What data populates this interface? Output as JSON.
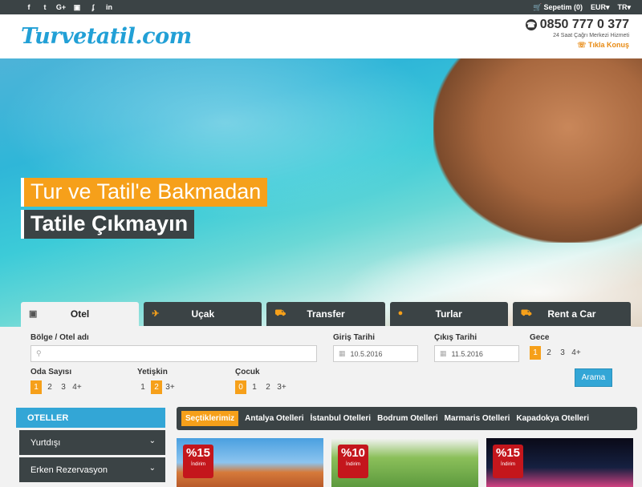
{
  "topbar": {
    "social": [
      "f",
      "t",
      "G+",
      "▣",
      "ʄ",
      "in"
    ],
    "cart_label": "Sepetim (0)",
    "currency": "EUR▾",
    "language": "TR▾"
  },
  "header": {
    "logo": "Turvetatil.com",
    "phone": "0850 777 0 377",
    "phone_sub": "24 Saat Çağrı Merkezi Hizmeti",
    "talk_link": "Tıkla Konuş"
  },
  "hero": {
    "line1": "Tur ve Tatil'e Bakmadan",
    "line2": "Tatile Çıkmayın"
  },
  "tabs": [
    {
      "label": "Otel",
      "icon": "▣"
    },
    {
      "label": "Uçak",
      "icon": "✈"
    },
    {
      "label": "Transfer",
      "icon": "⛟"
    },
    {
      "label": "Turlar",
      "icon": "●"
    },
    {
      "label": "Rent a Car",
      "icon": "⛟"
    }
  ],
  "search": {
    "region_label": "Bölge / Otel adı",
    "region_placeholder": "",
    "checkin_label": "Giriş Tarihi",
    "checkin_value": "10.5.2016",
    "checkout_label": "Çıkış Tarihi",
    "checkout_value": "11.5.2016",
    "nights_label": "Gece",
    "nights": [
      "1",
      "2",
      "3",
      "4+"
    ],
    "rooms_label": "Oda Sayısı",
    "rooms": [
      "1",
      "2",
      "3",
      "4+"
    ],
    "adults_label": "Yetişkin",
    "adults": [
      "1",
      "2",
      "3+"
    ],
    "children_label": "Çocuk",
    "children": [
      "0",
      "1",
      "2",
      "3+"
    ],
    "button": "Arama"
  },
  "sidebar": {
    "title": "OTELLER",
    "items": [
      "Yurtdışı",
      "Erken Rezervasyon"
    ]
  },
  "hotel_nav": [
    "Seçtiklerimiz",
    "Antalya Otelleri",
    "İstanbul Otelleri",
    "Bodrum Otelleri",
    "Marmaris Otelleri",
    "Kapadokya Otelleri"
  ],
  "cards": [
    {
      "pct": "%15",
      "sub": "İndirim"
    },
    {
      "pct": "%10",
      "sub": "İndirim"
    },
    {
      "pct": "%15",
      "sub": "İndirim"
    }
  ],
  "colors": {
    "accent": "#f6a01a",
    "dark": "#3b4345",
    "blue": "#33a6d6"
  }
}
